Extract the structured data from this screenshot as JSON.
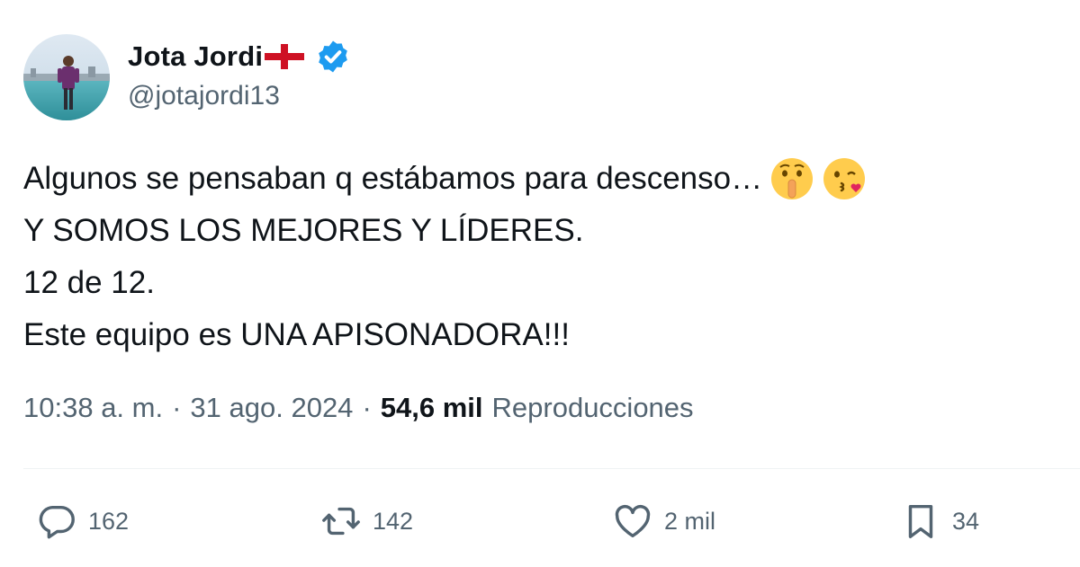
{
  "author": {
    "display_name": "Jota Jordi",
    "flag": "england-flag",
    "verified": true,
    "handle": "@jotajordi13"
  },
  "tweet": {
    "lines": [
      "Algunos se pensaban q estábamos para descenso…",
      "Y SOMOS LOS MEJORES Y LÍDERES.",
      "12 de 12.",
      "Este equipo es UNA APISONADORA!!!"
    ],
    "emojis": [
      "shushing-face-emoji",
      "face-blowing-kiss-emoji"
    ]
  },
  "meta": {
    "time": "10:38 a. m.",
    "separator": "·",
    "date": "31 ago. 2024",
    "views_count": "54,6 mil",
    "views_label": "Reproducciones"
  },
  "actions": {
    "replies": "162",
    "reposts": "142",
    "likes": "2 mil",
    "bookmarks": "34"
  },
  "colors": {
    "text": "#0f1419",
    "secondary": "#536471",
    "verified": "#1d9bf0",
    "divider": "#eff3f4"
  }
}
